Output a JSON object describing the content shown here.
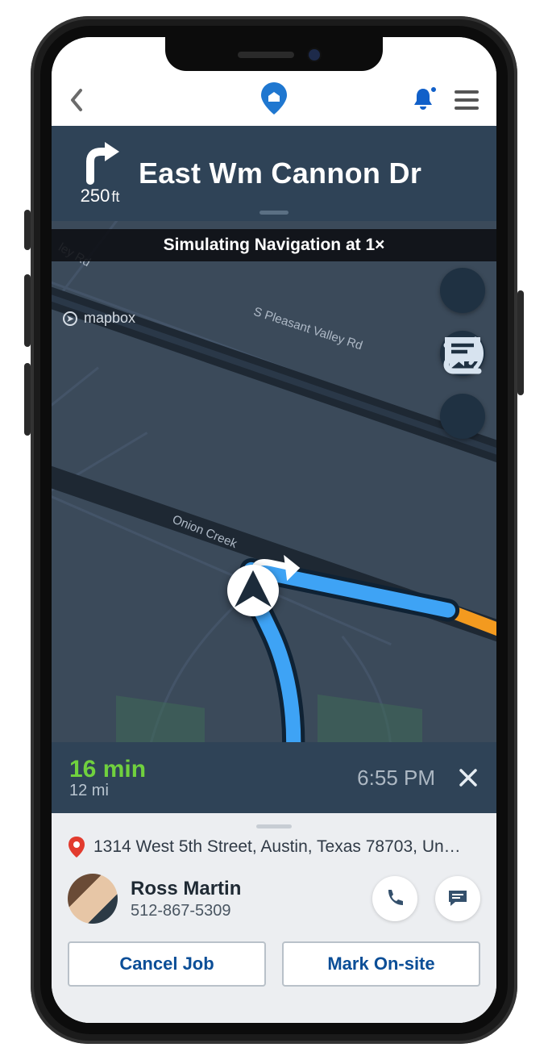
{
  "direction": {
    "distance_value": "250",
    "distance_unit": "ft",
    "street": "East Wm Cannon Dr"
  },
  "simulation_bar": "Simulating Navigation at 1×",
  "map": {
    "attribution": "mapbox",
    "road_1": "S Pleasant Valley Rd",
    "road_2": "Onion Creek",
    "road_3": "ley Rd"
  },
  "eta": {
    "duration": "16 min",
    "distance": "12 mi",
    "arrival": "6:55 PM"
  },
  "job": {
    "address": "1314 West 5th Street, Austin, Texas 78703, Un…",
    "contact_name": "Ross Martin",
    "contact_phone": "512-867-5309",
    "cancel_label": "Cancel Job",
    "mark_label": "Mark On-site"
  }
}
